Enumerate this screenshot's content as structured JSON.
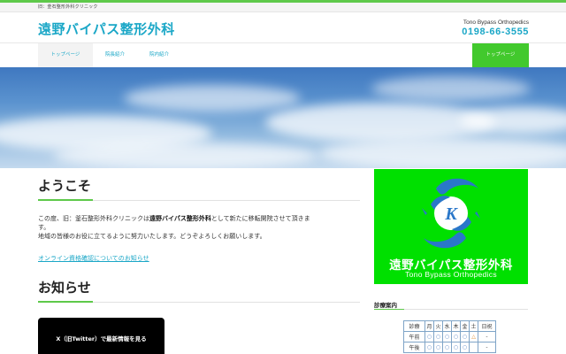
{
  "topbar": {
    "tagline": "旧：釜石整形外科クリニック"
  },
  "header": {
    "title": "遠野バイパス整形外科",
    "english_name": "Tono Bypass Orthopedics",
    "phone": "0198-66-3555"
  },
  "nav": {
    "items": [
      {
        "label": "トップページ",
        "active": true
      },
      {
        "label": "院長紹介",
        "active": false
      },
      {
        "label": "院内紹介",
        "active": false
      }
    ],
    "cta_label": "トップページ"
  },
  "welcome": {
    "heading": "ようこそ",
    "line1_before": "この度、旧：釜石整形外科クリニックは",
    "line1_bold": "遠野バイパス整形外科",
    "line1_after": "として新たに移転開院させて頂きま",
    "line2": "す。",
    "line3": "地域の皆様のお役に立てるように努力いたします。どうぞよろしくお願いします。",
    "link": "オンライン資格確認についてのお知らせ"
  },
  "news": {
    "heading": "お知らせ",
    "x_banner": "X（旧Twitter）で最新情報を見る"
  },
  "logo": {
    "jp": "遠野バイパス整形外科",
    "en": "Tono Bypass Orthopedics",
    "letter": "K"
  },
  "sidebar": {
    "schedule_heading": "診療案内",
    "schedule": {
      "corner": "診療",
      "days": [
        "月",
        "火",
        "水",
        "木",
        "金",
        "土",
        "日祝"
      ],
      "rows": [
        {
          "label": "午前",
          "marks": [
            "○",
            "○",
            "○",
            "○",
            "○",
            "△",
            "-"
          ]
        },
        {
          "label": "午後",
          "marks": [
            "○",
            "○",
            "○",
            "○",
            "○",
            "",
            "-"
          ]
        }
      ]
    }
  },
  "colors": {
    "accent": "#1ba7c7",
    "green": "#42c92d",
    "logo_bg": "#00e000"
  }
}
